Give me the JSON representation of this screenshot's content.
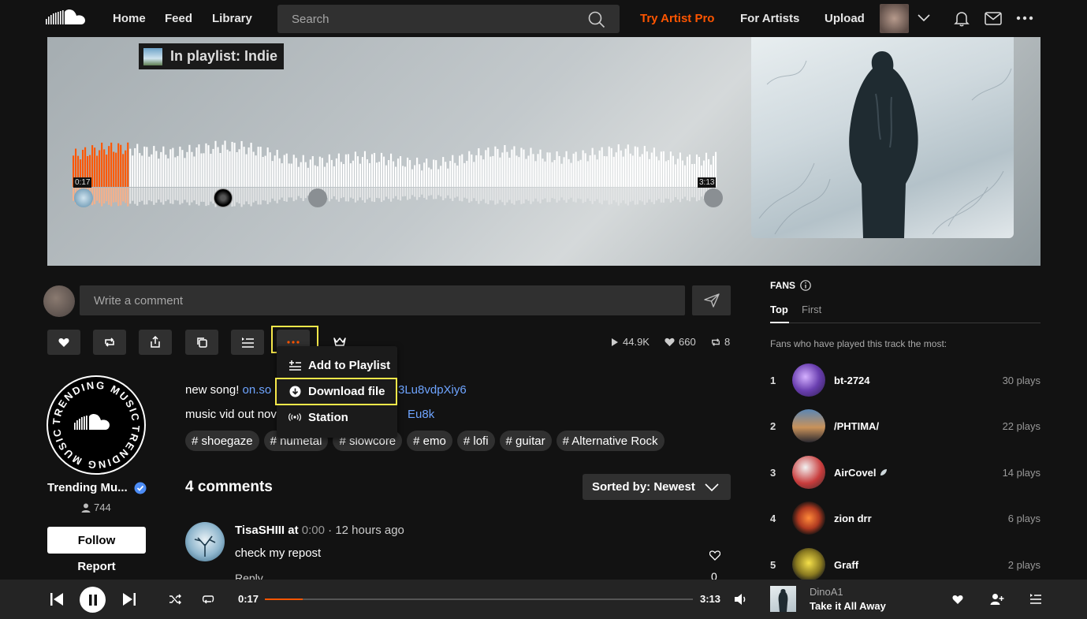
{
  "nav": {
    "home": "Home",
    "feed": "Feed",
    "library": "Library",
    "search_placeholder": "Search",
    "try_artist_pro": "Try Artist Pro",
    "for_artists": "For Artists",
    "upload": "Upload"
  },
  "colors": {
    "accent": "#ff5500",
    "highlight": "#f7e84a",
    "link": "#6ea4ff",
    "verified": "#4c8cf5"
  },
  "hero": {
    "playlist_label": "In playlist: Indie",
    "current_time": "0:17",
    "duration": "3:13",
    "progress": 0.088
  },
  "comment_box": {
    "placeholder": "Write a comment"
  },
  "actions": {
    "icons": [
      "heart-icon",
      "repost-icon",
      "share-icon",
      "copy-link-icon",
      "add-to-next-up-icon",
      "more-icon",
      "crown-icon"
    ]
  },
  "stats": {
    "plays": "44.9K",
    "likes": "660",
    "reposts": "8"
  },
  "more_menu": {
    "items": [
      {
        "label": "Add to Playlist",
        "icon": "add-to-playlist-icon"
      },
      {
        "label": "Download file",
        "icon": "download-icon"
      },
      {
        "label": "Station",
        "icon": "station-icon"
      }
    ]
  },
  "uploader": {
    "name": "Trending Mu...",
    "followers": "744",
    "follow_label": "Follow",
    "report_label": "Report",
    "badge_text": "TRENDING MUSIC"
  },
  "description": {
    "line1_text": "new song! ",
    "line1_link_a": "on.so",
    "line1_link_b": "3Lu8vdpXiy6",
    "line2_text": "music vid out nov",
    "line2_link": "Eu8k"
  },
  "tags": [
    "# shoegaze",
    "# numetal",
    "# slowcore",
    "# emo",
    "# lofi",
    "# guitar",
    "# Alternative Rock"
  ],
  "comments": {
    "count_label": "4 comments",
    "sort_label": "Sorted by: Newest",
    "first": {
      "user": "TisaSHIII",
      "at_label": "at",
      "at_time": "0:00",
      "ago": "· 12 hours ago",
      "text": "check my repost",
      "reply_label": "Reply",
      "likes": "0"
    }
  },
  "fans": {
    "title": "FANS",
    "tab_top": "Top",
    "tab_first": "First",
    "subtitle": "Fans who have played this track the most:",
    "list": [
      {
        "rank": "1",
        "name": "bt-2724",
        "plays": "30 plays"
      },
      {
        "rank": "2",
        "name": "/PHTIMA/",
        "plays": "22 plays"
      },
      {
        "rank": "3",
        "name": "AirCovel",
        "plays": "14 plays"
      },
      {
        "rank": "4",
        "name": "zion drr",
        "plays": "6 plays"
      },
      {
        "rank": "5",
        "name": "Graff",
        "plays": "2 plays"
      }
    ]
  },
  "player": {
    "current_time": "0:17",
    "duration": "3:13",
    "progress": 0.088,
    "artist": "DinoA1",
    "title": "Take it All Away"
  }
}
